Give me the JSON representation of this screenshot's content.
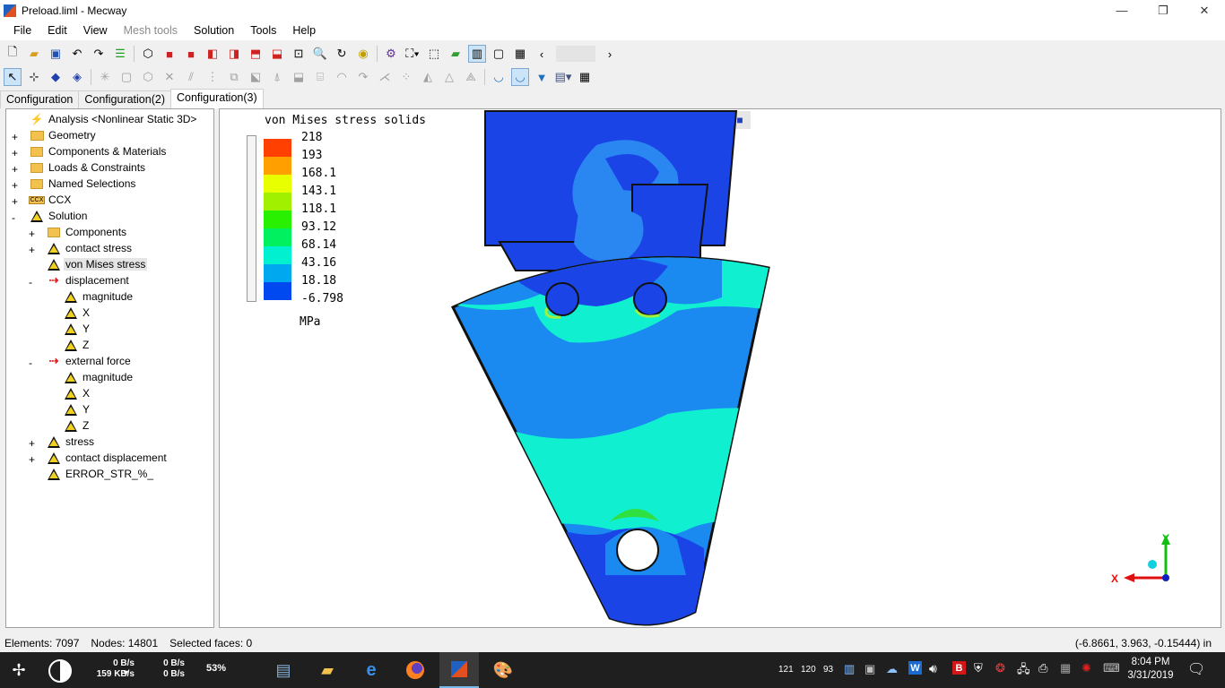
{
  "window": {
    "title": "Preload.liml - Mecway",
    "min_glyph": "—",
    "max_glyph": "❐",
    "close_glyph": "✕"
  },
  "menu": [
    {
      "label": "File",
      "enabled": true
    },
    {
      "label": "Edit",
      "enabled": true
    },
    {
      "label": "View",
      "enabled": true
    },
    {
      "label": "Mesh tools",
      "enabled": false
    },
    {
      "label": "Solution",
      "enabled": true
    },
    {
      "label": "Tools",
      "enabled": true
    },
    {
      "label": "Help",
      "enabled": true
    }
  ],
  "tabs": [
    {
      "label": "Configuration",
      "active": false
    },
    {
      "label": "Configuration(2)",
      "active": false
    },
    {
      "label": "Configuration(3)",
      "active": true
    }
  ],
  "tree": {
    "items": [
      {
        "label": "Analysis <Nonlinear Static 3D>",
        "icon": "analysis-icon",
        "level": 1,
        "expander": "none"
      },
      {
        "label": "Geometry",
        "icon": "folder-icon",
        "level": 1,
        "expander": "+"
      },
      {
        "label": "Components & Materials",
        "icon": "components-icon",
        "level": 1,
        "expander": "+"
      },
      {
        "label": "Loads & Constraints",
        "icon": "loads-icon",
        "level": 1,
        "expander": "+"
      },
      {
        "label": "Named Selections",
        "icon": "named-selections-icon",
        "level": 1,
        "expander": "+"
      },
      {
        "label": "CCX",
        "icon": "ccx-icon",
        "level": 1,
        "expander": "+"
      },
      {
        "label": "Solution",
        "icon": "solution-icon",
        "level": 1,
        "expander": "-"
      },
      {
        "label": "Components",
        "icon": "components-icon",
        "level": 2,
        "expander": "+"
      },
      {
        "label": "contact stress",
        "icon": "contour-icon",
        "level": 2,
        "expander": "+"
      },
      {
        "label": "von Mises stress",
        "icon": "contour-icon",
        "level": 2,
        "expander": "none",
        "selected": true
      },
      {
        "label": "displacement",
        "icon": "vector-icon",
        "level": 2,
        "expander": "-"
      },
      {
        "label": "magnitude",
        "icon": "contour-icon",
        "level": 3,
        "expander": "none"
      },
      {
        "label": "X",
        "icon": "contour-icon",
        "level": 3,
        "expander": "none"
      },
      {
        "label": "Y",
        "icon": "contour-icon",
        "level": 3,
        "expander": "none"
      },
      {
        "label": "Z",
        "icon": "contour-icon",
        "level": 3,
        "expander": "none"
      },
      {
        "label": "external force",
        "icon": "vector-icon",
        "level": 2,
        "expander": "-"
      },
      {
        "label": "magnitude",
        "icon": "contour-icon",
        "level": 3,
        "expander": "none"
      },
      {
        "label": "X",
        "icon": "contour-icon",
        "level": 3,
        "expander": "none"
      },
      {
        "label": "Y",
        "icon": "contour-icon",
        "level": 3,
        "expander": "none"
      },
      {
        "label": "Z",
        "icon": "contour-icon",
        "level": 3,
        "expander": "none"
      },
      {
        "label": "stress",
        "icon": "contour-icon",
        "level": 2,
        "expander": "+"
      },
      {
        "label": "contact displacement",
        "icon": "contour-icon",
        "level": 2,
        "expander": "+"
      },
      {
        "label": "ERROR_STR_%_",
        "icon": "contour-icon",
        "level": 2,
        "expander": "none"
      }
    ]
  },
  "legend": {
    "title": "von Mises stress solids",
    "values": [
      "218",
      "193",
      "168.1",
      "143.1",
      "118.1",
      "93.12",
      "68.14",
      "43.16",
      "18.18",
      "-6.798"
    ],
    "colors": [
      "#ff4000",
      "#ffa000",
      "#e8ff00",
      "#a0f000",
      "#28f000",
      "#00f060",
      "#00f0d0",
      "#00a8f0",
      "#0048f0"
    ],
    "unit": "MPa"
  },
  "triad": {
    "x": "X",
    "y": "Y"
  },
  "status": {
    "elements": "Elements: 7097",
    "nodes": "Nodes: 14801",
    "selected": "Selected faces: 0",
    "coords": "(-6.8661, 3.963, -0.15444) in"
  },
  "taskbar": {
    "net_up": "0 B/s",
    "net_down": "159 KB/s",
    "disk_read": "0 B/s",
    "disk_write": "0 B/s",
    "cpu": "53%",
    "tray_nums": [
      "121",
      "120",
      "93"
    ],
    "time": "8:04 PM",
    "date": "3/31/2019"
  }
}
